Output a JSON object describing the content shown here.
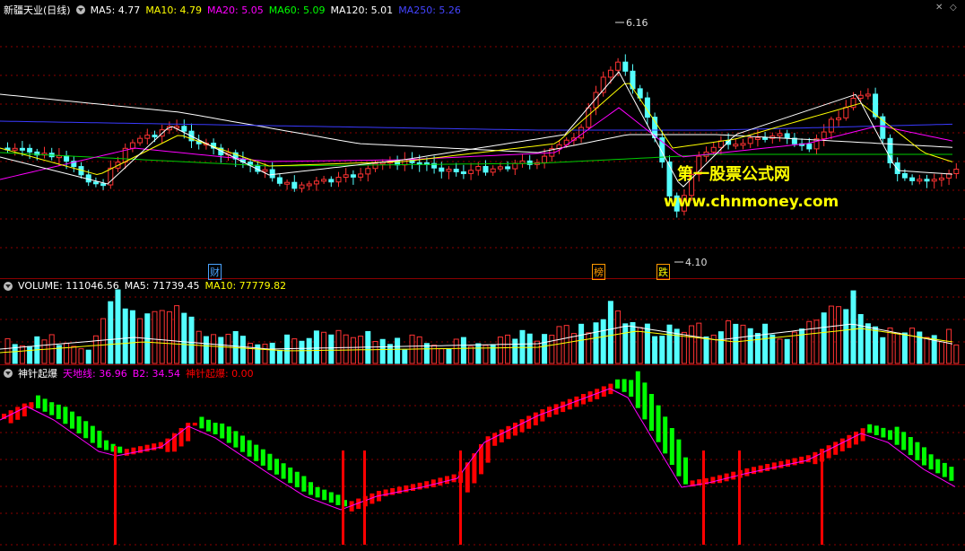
{
  "price_panel": {
    "title": "新疆天业(日线)",
    "ma_items": [
      {
        "label": "MA5: 4.77",
        "color": "#ffffff"
      },
      {
        "label": "MA10: 4.79",
        "color": "#ffff00"
      },
      {
        "label": "MA20: 5.05",
        "color": "#ff00ff"
      },
      {
        "label": "MA60: 5.09",
        "color": "#00ff00"
      },
      {
        "label": "MA120: 5.01",
        "color": "#ffffff"
      },
      {
        "label": "MA250: 5.26",
        "color": "#4444ff"
      }
    ],
    "high_label": "6.16",
    "low_label": "4.10",
    "events": [
      {
        "text": "财",
        "color": "#4aa3ff"
      },
      {
        "text": "榜",
        "color": "#ff9900"
      },
      {
        "text": "跌",
        "color": "#ffff00"
      }
    ],
    "watermark_line1": "第一股票公式网",
    "watermark_line2": "www.chnmoney.com"
  },
  "volume_panel": {
    "items": [
      {
        "label": "VOLUME: 111046.56",
        "color": "#ffffff"
      },
      {
        "label": "MA5: 71739.45",
        "color": "#ffffff"
      },
      {
        "label": "MA10: 77779.82",
        "color": "#ffff00"
      }
    ]
  },
  "osc_panel": {
    "items": [
      {
        "label": "神针起爆",
        "color": "#ffffff"
      },
      {
        "label": "天地线: 36.96",
        "color": "#ff00ff"
      },
      {
        "label": "B2: 34.54",
        "color": "#ff00ff"
      },
      {
        "label": "神针起爆: 0.00",
        "color": "#ff0000"
      }
    ]
  },
  "colors": {
    "up": "#ff3333",
    "down": "#54ffff",
    "osc_up": "#ff0000",
    "osc_down": "#00ff00",
    "grid": "#8b0000"
  }
}
